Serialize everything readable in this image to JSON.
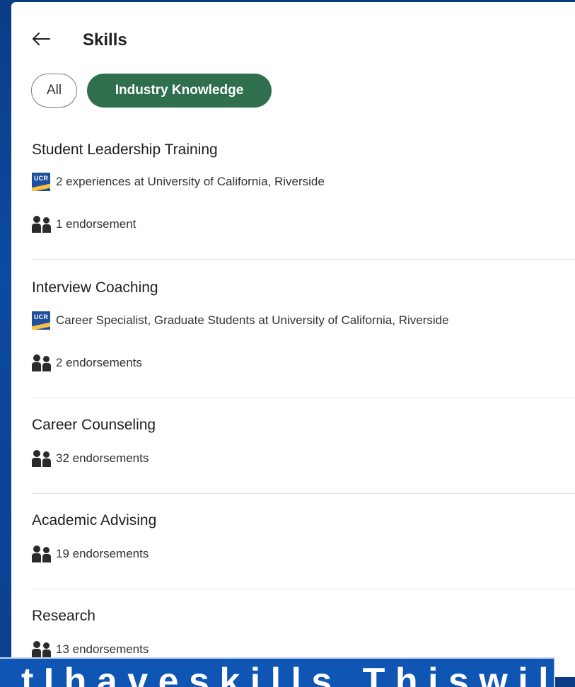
{
  "header": {
    "title": "Skills"
  },
  "filters": {
    "all_label": "All",
    "active_label": "Industry Knowledge"
  },
  "skills": [
    {
      "name": "Student Leadership Training",
      "experience": "2 experiences at University of California, Riverside",
      "endorsements": "1 endorsement"
    },
    {
      "name": "Interview Coaching",
      "experience": "Career Specialist, Graduate Students at University of California, Riverside",
      "endorsements": "2 endorsements"
    },
    {
      "name": "Career Counseling",
      "endorsements": "32 endorsements"
    },
    {
      "name": "Academic Advising",
      "endorsements": "19 endorsements"
    },
    {
      "name": "Research",
      "endorsements": "13 endorsements"
    }
  ],
  "logo": {
    "text": "UCR"
  },
  "banner": {
    "text": "t I h a v e  s k i l l s .  T h i s  w i l l  s h o w"
  },
  "colors": {
    "active_pill": "#2f6f4e",
    "background": "#0d4aa0",
    "banner": "#0f56b4"
  }
}
